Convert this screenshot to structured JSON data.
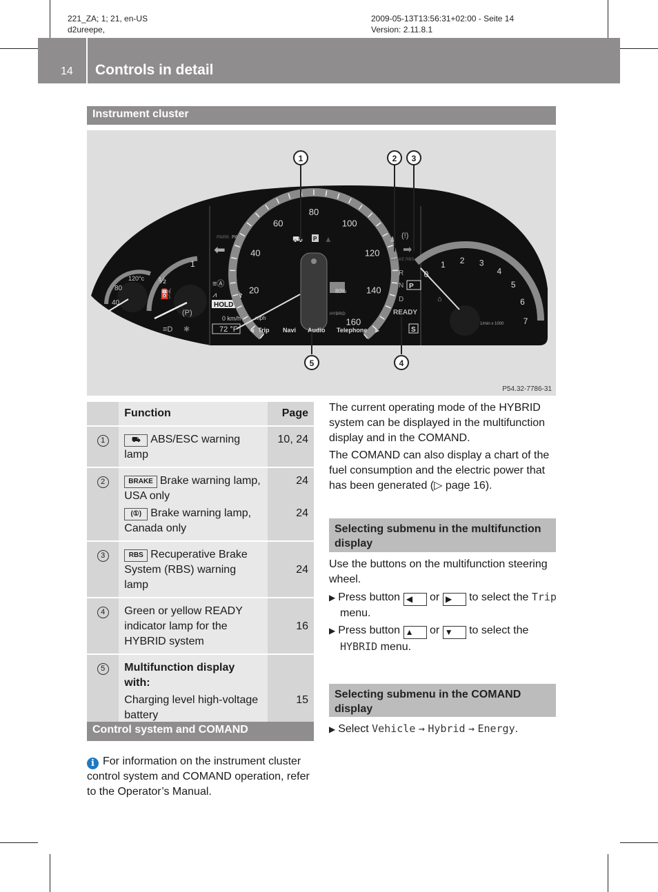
{
  "print_meta": {
    "left_line1": "221_ZA; 1; 21, en-US",
    "left_line2": "d2ureepe,",
    "right_line1": "2009-05-13T13:56:31+02:00 - Seite 14",
    "right_line2": "Version: 2.11.8.1"
  },
  "header": {
    "page_number": "14",
    "chapter_title": "Controls in detail"
  },
  "sections": {
    "instrument_cluster": "Instrument cluster",
    "control_system": "Control system and COMAND",
    "submenu_multifunction": "Selecting submenu in the multifunction display",
    "submenu_comand": "Selecting submenu in the COMAND display"
  },
  "figure": {
    "caption_code": "P54.32-7786-31",
    "callouts": [
      "1",
      "2",
      "3",
      "4",
      "5"
    ],
    "speedometer_labels": [
      "20",
      "40",
      "60",
      "80",
      "100",
      "120",
      "140",
      "160"
    ],
    "tachometer_labels": [
      "0",
      "1",
      "2",
      "3",
      "4",
      "5",
      "6",
      "7"
    ],
    "tacho_unit": "1/min x 1000",
    "temp_labels": [
      "40",
      "80",
      "120°c"
    ],
    "fuel_labels": [
      "1",
      "½"
    ],
    "menu_items": [
      "Trip",
      "Navi",
      "Audio",
      "Telephone"
    ],
    "gear_labels": [
      "R",
      "N",
      "D"
    ],
    "gear_selected": "P",
    "ready_label": "READY",
    "mode_label": "S",
    "hold_label": "HOLD",
    "outside_temp": "72 °F",
    "speed_readout": "0 km/h",
    "mph_label": "mph",
    "battery_percent": "80%",
    "hybrid_label": "HYBRID",
    "park_labels": [
      "PARK",
      "PARK"
    ],
    "brake_rbs_label": "BRAKE RBS"
  },
  "table": {
    "headers": {
      "num": "",
      "function": "Function",
      "page": "Page"
    },
    "rows": [
      {
        "num": "1",
        "entries": [
          {
            "icon": "abs-esc-icon",
            "icon_text": "⛟",
            "text": "ABS/ESC warning lamp",
            "bold": false,
            "page": "10, 24"
          }
        ]
      },
      {
        "num": "2",
        "entries": [
          {
            "icon": "brake-icon",
            "icon_text": "BRAKE",
            "text": "Brake warning lamp, USA only",
            "bold": false,
            "page": "24"
          },
          {
            "icon": "brake-circle-icon",
            "icon_text": "(①)",
            "text": "Brake warning lamp, Canada only",
            "bold": false,
            "page": "24"
          }
        ]
      },
      {
        "num": "3",
        "entries": [
          {
            "icon": "rbs-icon",
            "icon_text": "RBS",
            "text": "Recuperative Brake System (RBS) warning lamp",
            "bold": false,
            "page": "24"
          }
        ]
      },
      {
        "num": "4",
        "entries": [
          {
            "icon": "",
            "icon_text": "",
            "text": "Green or yellow READY indicator lamp for the HYBRID system",
            "bold": false,
            "page": "16"
          }
        ]
      },
      {
        "num": "5",
        "entries": [
          {
            "icon": "",
            "icon_text": "",
            "text": "Multifunction display with:",
            "bold": true,
            "page": ""
          },
          {
            "icon": "",
            "icon_text": "",
            "text": "Charging level high-voltage battery",
            "bold": false,
            "page": "15"
          }
        ]
      }
    ]
  },
  "right_col": {
    "para1": "The current operating mode of the HYBRID system can be displayed in the multifunction display and in the COMAND.",
    "para2_a": "The COMAND can also display a chart of the fuel consumption and the electric power that has been generated (",
    "para2_ref": "▷ page 16",
    "para2_b": ").",
    "mf_intro": "Use the buttons on the multifunction steering wheel.",
    "step1": {
      "a": "Press button",
      "key1": "◀",
      "or": "or",
      "key2": "▶",
      "b": "to select the",
      "menu": "Trip",
      "c": "menu."
    },
    "step2": {
      "a": "Press button",
      "key1": "▲",
      "or": "or",
      "key2": "▼",
      "b": "to select the",
      "menu": "HYBRID",
      "c": "menu."
    },
    "comand_step": {
      "a": "Select",
      "path1": "Vehicle",
      "arrow1": "→",
      "path2": "Hybrid",
      "arrow2": "→",
      "path3": "Energy",
      "end": "."
    }
  },
  "info_note": {
    "icon": "info-icon",
    "text": "For information on the instrument cluster control system and COMAND operation, refer to the Operator’s Manual."
  }
}
